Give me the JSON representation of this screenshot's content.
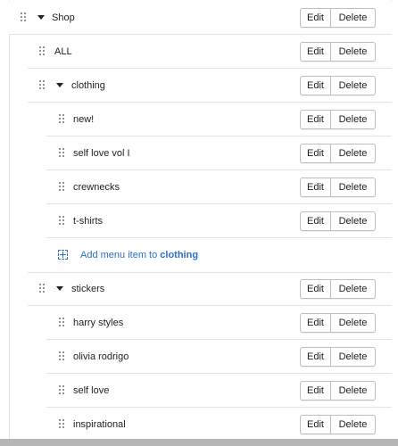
{
  "menu": {
    "edit_label": "Edit",
    "delete_label": "Delete",
    "top": {
      "label": "Shop"
    },
    "level1": [
      {
        "label": "ALL"
      },
      {
        "label": "clothing"
      }
    ],
    "clothing_children": [
      {
        "label": "new!"
      },
      {
        "label": "self love vol I"
      },
      {
        "label": "crewnecks"
      },
      {
        "label": "t-shirts"
      }
    ],
    "add_item": {
      "prefix": "Add menu item to",
      "target": "clothing"
    },
    "stickers": {
      "label": "stickers"
    },
    "stickers_children": [
      {
        "label": "harry styles"
      },
      {
        "label": "olivia rodrigo"
      },
      {
        "label": "self love"
      },
      {
        "label": "inspirational"
      }
    ]
  }
}
